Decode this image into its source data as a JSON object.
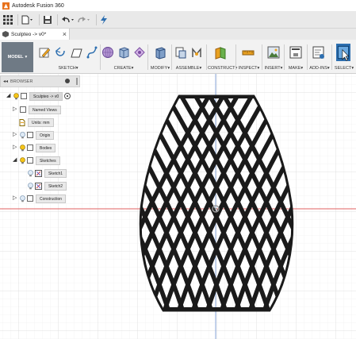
{
  "window": {
    "title": "Autodesk Fusion 360"
  },
  "document_tab": {
    "label": "Sculpteo -> v0*"
  },
  "toolbar": {
    "mode_label": "MODEL",
    "groups": [
      {
        "label": "SKETCH"
      },
      {
        "label": "CREATE"
      },
      {
        "label": "MODIFY"
      },
      {
        "label": "ASSEMBLE"
      },
      {
        "label": "CONSTRUCT"
      },
      {
        "label": "INSPECT"
      },
      {
        "label": "INSERT"
      },
      {
        "label": "MAKE"
      },
      {
        "label": "ADD-INS"
      },
      {
        "label": "SELECT"
      }
    ]
  },
  "browser": {
    "title": "BROWSER",
    "root": "Sculpteo -> v0",
    "items": [
      {
        "label": "Named Views"
      },
      {
        "label": "Units: mm"
      },
      {
        "label": "Origin"
      },
      {
        "label": "Bodies"
      },
      {
        "label": "Sketches"
      },
      {
        "label": "Sketch1"
      },
      {
        "label": "Sketch2"
      },
      {
        "label": "Construction"
      }
    ]
  },
  "colors": {
    "toolbar_bg": "#f2f2f2",
    "mode_button": "#6f7a85",
    "select_highlight": "#2d6fb0",
    "model": "#1a1a1a",
    "axis_red": "#e06060",
    "axis_blue": "#7a9bd6"
  }
}
